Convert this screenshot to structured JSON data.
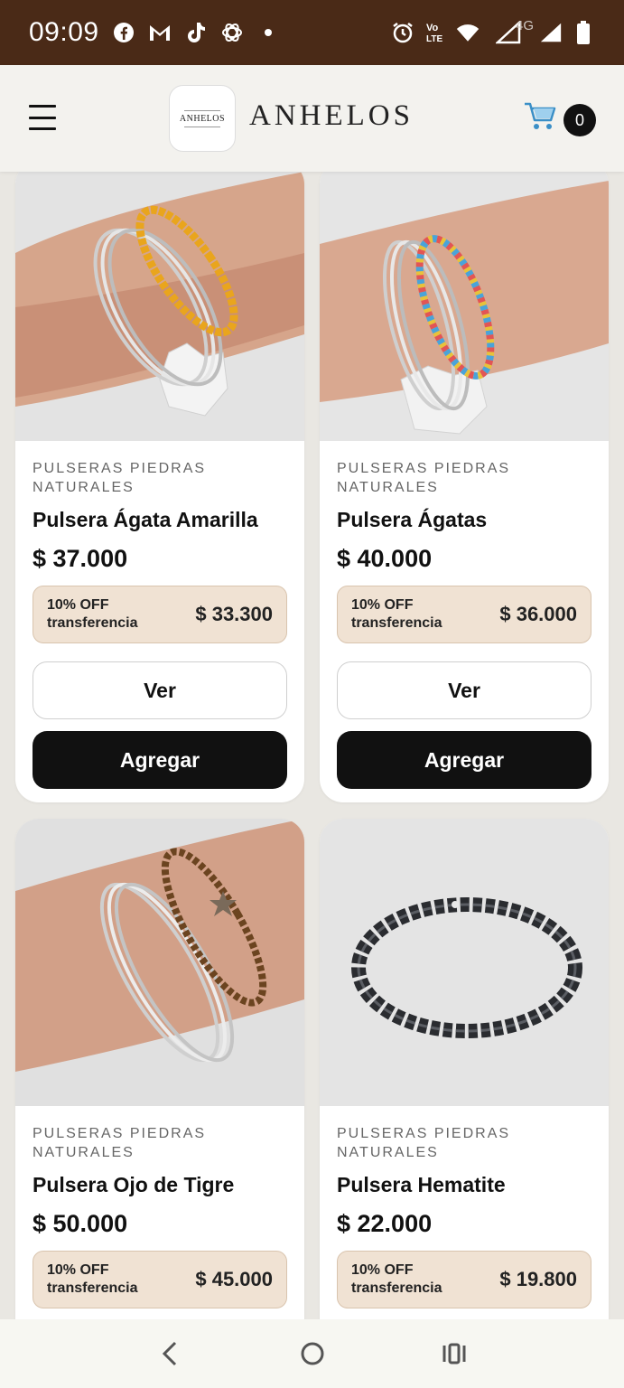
{
  "status_bar": {
    "time": "09:09",
    "network": "4G",
    "volte": "Vo\nLTE",
    "left_icons": [
      "facebook-icon",
      "gmail-icon",
      "tiktok-icon",
      "chatgpt-icon",
      "dot-icon"
    ],
    "right_icons": [
      "alarm-icon",
      "volte-icon",
      "wifi-icon",
      "signal-icon",
      "signal-icon",
      "battery-icon"
    ]
  },
  "header": {
    "brand": "ANHELOS",
    "logo_text": "ANHELOS",
    "cart_count": "0"
  },
  "products": [
    {
      "category": "PULSERAS PIEDRAS NATURALES",
      "title": "Pulsera Ágata Amarilla",
      "price": "$ 37.000",
      "discount_label": "10% OFF transferencia",
      "discount_price": "$ 33.300",
      "view_label": "Ver",
      "add_label": "Agregar",
      "bead_color": "#e9a51d"
    },
    {
      "category": "PULSERAS PIEDRAS NATURALES",
      "title": "Pulsera Ágatas",
      "price": "$ 40.000",
      "discount_label": "10% OFF transferencia",
      "discount_price": "$ 36.000",
      "view_label": "Ver",
      "add_label": "Agregar",
      "bead_color": "multicolor"
    },
    {
      "category": "PULSERAS PIEDRAS NATURALES",
      "title": "Pulsera Ojo de Tigre",
      "price": "$ 50.000",
      "discount_label": "10% OFF transferencia",
      "discount_price": "$ 45.000",
      "view_label": "Ver",
      "add_label": "Agregar",
      "bead_color": "#6b4420"
    },
    {
      "category": "PULSERAS PIEDRAS NATURALES",
      "title": "Pulsera Hematite",
      "price": "$ 22.000",
      "discount_label": "10% OFF transferencia",
      "discount_price": "$ 19.800",
      "view_label": "Ver",
      "add_label": "Agregar",
      "bead_color": "#2a2c30"
    }
  ],
  "colors": {
    "status_bar": "#4a2a17",
    "header_bg": "#f3f2ee",
    "discount_bg": "#f0e2d3",
    "button_dark": "#111111",
    "page_bg": "#e9e7e2"
  }
}
